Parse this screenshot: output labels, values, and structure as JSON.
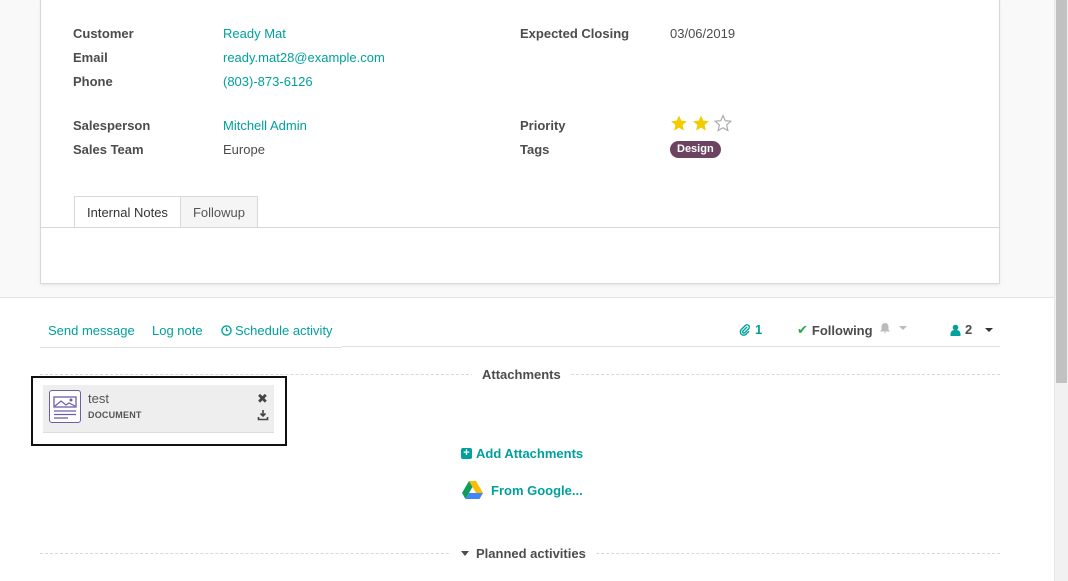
{
  "form": {
    "customer_label": "Customer",
    "customer_value": "Ready Mat",
    "email_label": "Email",
    "email_value": "ready.mat28@example.com",
    "phone_label": "Phone",
    "phone_value": "(803)-873-6126",
    "salesperson_label": "Salesperson",
    "salesperson_value": "Mitchell Admin",
    "sales_team_label": "Sales Team",
    "sales_team_value": "Europe",
    "expected_closing_label": "Expected Closing",
    "expected_closing_value": "03/06/2019",
    "priority_label": "Priority",
    "priority_stars": 2,
    "priority_max": 3,
    "tags_label": "Tags",
    "tags": [
      "Design"
    ],
    "tag_color": "#6c4462"
  },
  "tabs": [
    {
      "label": "Internal Notes",
      "active": true
    },
    {
      "label": "Followup",
      "active": false
    }
  ],
  "chatter": {
    "send_message": "Send message",
    "log_note": "Log note",
    "schedule_activity": "Schedule activity",
    "attachments_count": "1",
    "following": "Following",
    "followers_count": "2"
  },
  "attachments": {
    "section_title": "Attachments",
    "items": [
      {
        "name": "test",
        "type": "DOCUMENT"
      }
    ],
    "add_label": "Add Attachments",
    "google_label": "From Google..."
  },
  "planned": {
    "section_title": "Planned activities"
  },
  "colors": {
    "accent": "#00a09d",
    "star_filled": "#f3cc00",
    "star_empty": "#a8a8a8"
  }
}
